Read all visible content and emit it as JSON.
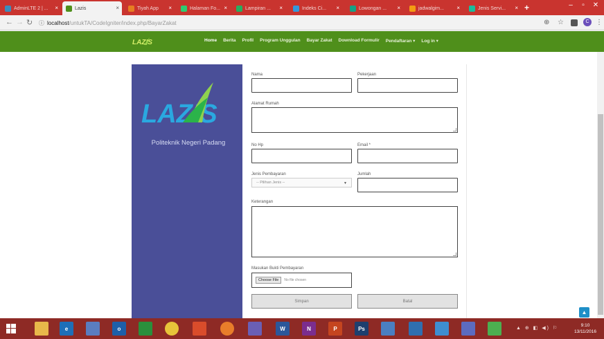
{
  "browser": {
    "tabs": [
      {
        "label": "AdminLTE 2 | ...",
        "fav_color": "#3c8dbc",
        "x": 0
      },
      {
        "label": "Lazis",
        "fav_color": "#4f8f1b",
        "x": 0
      },
      {
        "label": "Tiyah App",
        "fav_color": "#e67e22",
        "x": 0
      },
      {
        "label": "Halaman Fo...",
        "fav_color": "#2ecc71",
        "x": 0
      },
      {
        "label": "Lampiran ...",
        "fav_color": "#27ae60",
        "x": 0
      },
      {
        "label": "Indeks Ci...",
        "fav_color": "#3498db",
        "x": 0
      },
      {
        "label": "Lowongan ...",
        "fav_color": "#16a085",
        "x": 0
      },
      {
        "label": "jadwalgim...",
        "fav_color": "#f39c12",
        "x": 0
      },
      {
        "label": "Jenis Servi...",
        "fav_color": "#1abc9c",
        "x": 0
      }
    ],
    "new_tab": "+",
    "url_host": "localhost",
    "url_path": "/untukTA/CodeIgniter/index.php/BayarZakat",
    "secure_icon": "ⓘ",
    "avatar_letter": "C"
  },
  "site": {
    "logo_text": "LAZIS",
    "nav": [
      "Home",
      "Berita",
      "Profil",
      "Program Unggulan",
      "Bayar Zakat",
      "Download Formulir",
      "Pendaftaran ▾",
      "Log in ▾"
    ],
    "active_nav": "Home"
  },
  "brand": {
    "logo_text": "LAZIS",
    "institution": "Politeknik Negeri Padang"
  },
  "form": {
    "nama_label": "Nama",
    "pekerjaan_label": "Pekerjaan",
    "alamat_label": "Alamat Rumah",
    "nohp_label": "No Hp",
    "email_label": "Email *",
    "jenis_label": "Jenis Pembayaran",
    "jenis_placeholder": "-- Pilihan Jenis --",
    "jumlah_label": "Jumlah",
    "keterangan_label": "Keterangan",
    "bukti_label": "Masukan Bukti Pembayaran",
    "choose_file": "Choose File",
    "no_file": "No file chosen",
    "simpan": "Simpan",
    "batal": "Batal"
  },
  "taskbar": {
    "clock_time": "9:10",
    "clock_date": "13/11/2016",
    "tray": "▲ ⊕ ◧ ◀) ⚐"
  },
  "colors": {
    "site_green": "#4f8f1b",
    "panel_blue": "#4a4f98",
    "tabstrip_red": "#c9342f",
    "taskbar_red": "#8e2a25"
  }
}
